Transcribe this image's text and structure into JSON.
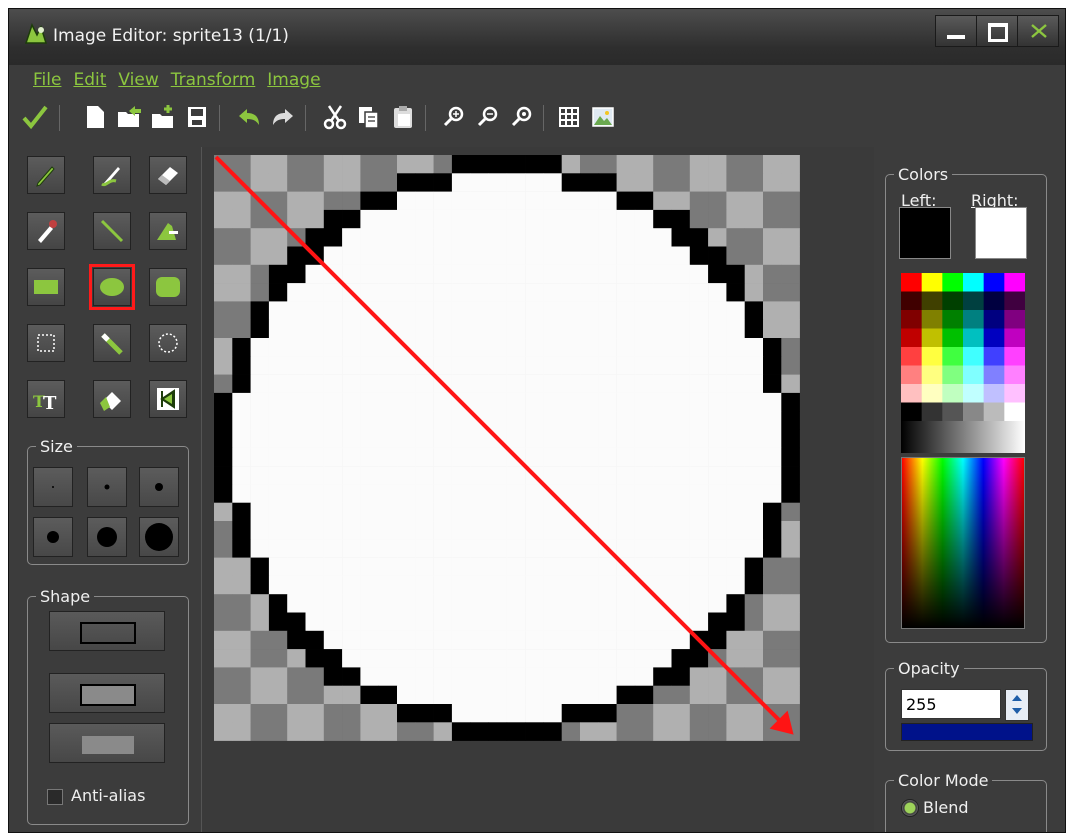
{
  "window": {
    "title": "Image Editor: sprite13 (1/1)",
    "buttons": [
      "minimize",
      "maximize",
      "close"
    ]
  },
  "menu": [
    "File",
    "Edit",
    "View",
    "Transform",
    "Image"
  ],
  "toolbar": {
    "icons": [
      "checkmark-icon",
      "new-file-icon",
      "open-file-icon",
      "add-file-icon",
      "save-icon",
      "undo-icon",
      "redo-icon",
      "cut-icon",
      "copy-icon",
      "paste-icon",
      "zoom-in-icon",
      "zoom-out-icon",
      "zoom-reset-icon",
      "grid-icon",
      "image-icon"
    ]
  },
  "tools": {
    "selected": "ellipse-tool"
  },
  "size_panel": {
    "label": "Size"
  },
  "shape_panel": {
    "label": "Shape",
    "antialias_label": "Anti-alias"
  },
  "colors_panel": {
    "label": "Colors",
    "left_label": "Left:",
    "right_label": "Right:",
    "left_color": "#000000",
    "right_color": "#ffffff"
  },
  "opacity_panel": {
    "label": "Opacity",
    "value": "255",
    "bar_color": "#00128a"
  },
  "color_mode_panel": {
    "label": "Color Mode",
    "option_blend": "Blend"
  },
  "accent": "#8cc63f"
}
